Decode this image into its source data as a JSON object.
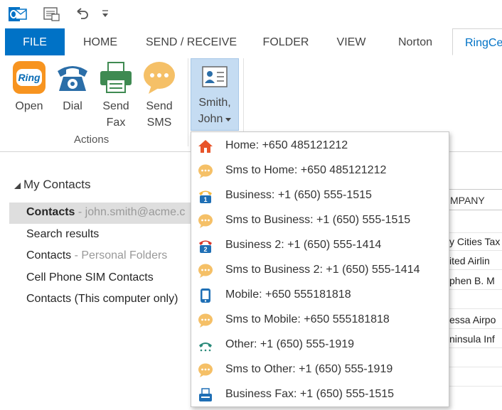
{
  "tabs": [
    {
      "label": "FILE"
    },
    {
      "label": "HOME"
    },
    {
      "label": "SEND / RECEIVE"
    },
    {
      "label": "FOLDER"
    },
    {
      "label": "VIEW"
    },
    {
      "label": "Norton"
    },
    {
      "label": "RingCe"
    }
  ],
  "ribbon": {
    "actions": {
      "open_label": "Open",
      "ring_text": "Ring",
      "dial_label": "Dial",
      "send_fax_label_1": "Send",
      "send_fax_label_2": "Fax",
      "send_sms_label_1": "Send",
      "send_sms_label_2": "SMS",
      "group_label": "Actions"
    },
    "contact_button": {
      "line1": "Smith,",
      "line2": "John"
    }
  },
  "nav": {
    "header": "My Contacts",
    "items": [
      {
        "label": "Contacts",
        "sub": " - john.smith@acme.c"
      },
      {
        "label": "Search results",
        "sub": ""
      },
      {
        "label": "Contacts",
        "sub": " - Personal Folders"
      },
      {
        "label": "Cell Phone SIM Contacts",
        "sub": ""
      },
      {
        "label": "Contacts (This computer only)",
        "sub": ""
      }
    ]
  },
  "table": {
    "column_header": "MPANY",
    "cells": [
      "y Cities Tax",
      "ited Airlin",
      "phen B. M",
      "essa Airpo",
      "ninsula Inf"
    ]
  },
  "menu": {
    "items": [
      {
        "label": "Home: +650 485121212",
        "icon": "home-icon",
        "color": "#e8542a"
      },
      {
        "label": "Sms to Home: +650 485121212",
        "icon": "sms-bubble-icon",
        "color": "#f5b942"
      },
      {
        "label": "Business: +1 (650) 555-1515",
        "icon": "business-phone-icon",
        "color": "#1f6fb5"
      },
      {
        "label": "Sms to Business: +1 (650) 555-1515",
        "icon": "sms-bubble-icon",
        "color": "#f5b942"
      },
      {
        "label": "Business 2: +1 (650) 555-1414",
        "icon": "business-phone-2-icon",
        "color": "#d9382a"
      },
      {
        "label": "Sms to Business 2: +1 (650) 555-1414",
        "icon": "sms-bubble-icon",
        "color": "#f5b942"
      },
      {
        "label": "Mobile: +650 555181818",
        "icon": "mobile-phone-icon",
        "color": "#1f6fb5"
      },
      {
        "label": "Sms to Mobile: +650 555181818",
        "icon": "sms-bubble-icon",
        "color": "#f5b942"
      },
      {
        "label": "Other: +1 (650) 555-1919",
        "icon": "other-phone-icon",
        "color": "#2a8a7a"
      },
      {
        "label": "Sms to Other: +1 (650) 555-1919",
        "icon": "sms-bubble-icon",
        "color": "#f5b942"
      },
      {
        "label": "Business Fax: +1 (650) 555-1515",
        "icon": "fax-icon",
        "color": "#1f6fb5"
      }
    ]
  }
}
